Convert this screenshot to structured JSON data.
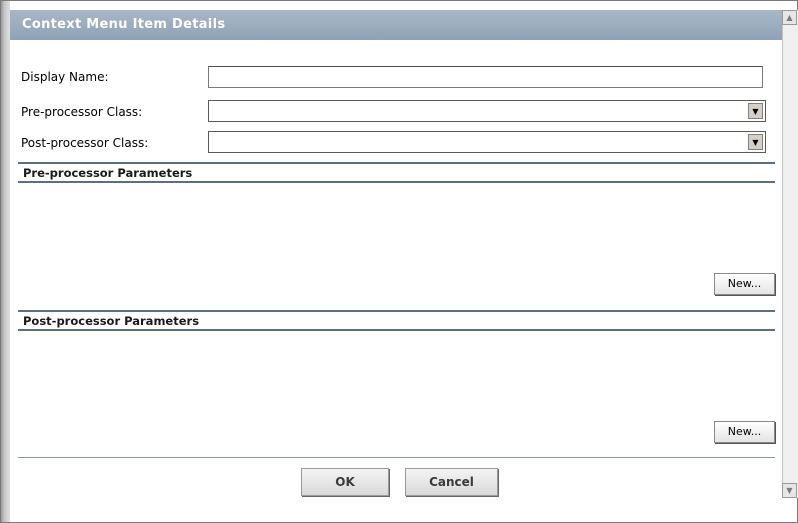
{
  "window": {
    "title": "Context Menu Item Details"
  },
  "form": {
    "display_name": {
      "label": "Display Name:",
      "value": ""
    },
    "pre_processor_class": {
      "label": "Pre-processor Class:",
      "value": ""
    },
    "post_processor_class": {
      "label": "Post-processor Class:",
      "value": ""
    }
  },
  "sections": {
    "pre_parameters": {
      "title": "Pre-processor Parameters",
      "new_label": "New..."
    },
    "post_parameters": {
      "title": "Post-processor Parameters",
      "new_label": "New..."
    }
  },
  "actions": {
    "ok_label": "OK",
    "cancel_label": "Cancel"
  },
  "icons": {
    "scroll_up": "scroll-up-arrow-icon",
    "scroll_down": "scroll-down-arrow-icon",
    "dropdown": "chevron-down-icon"
  }
}
